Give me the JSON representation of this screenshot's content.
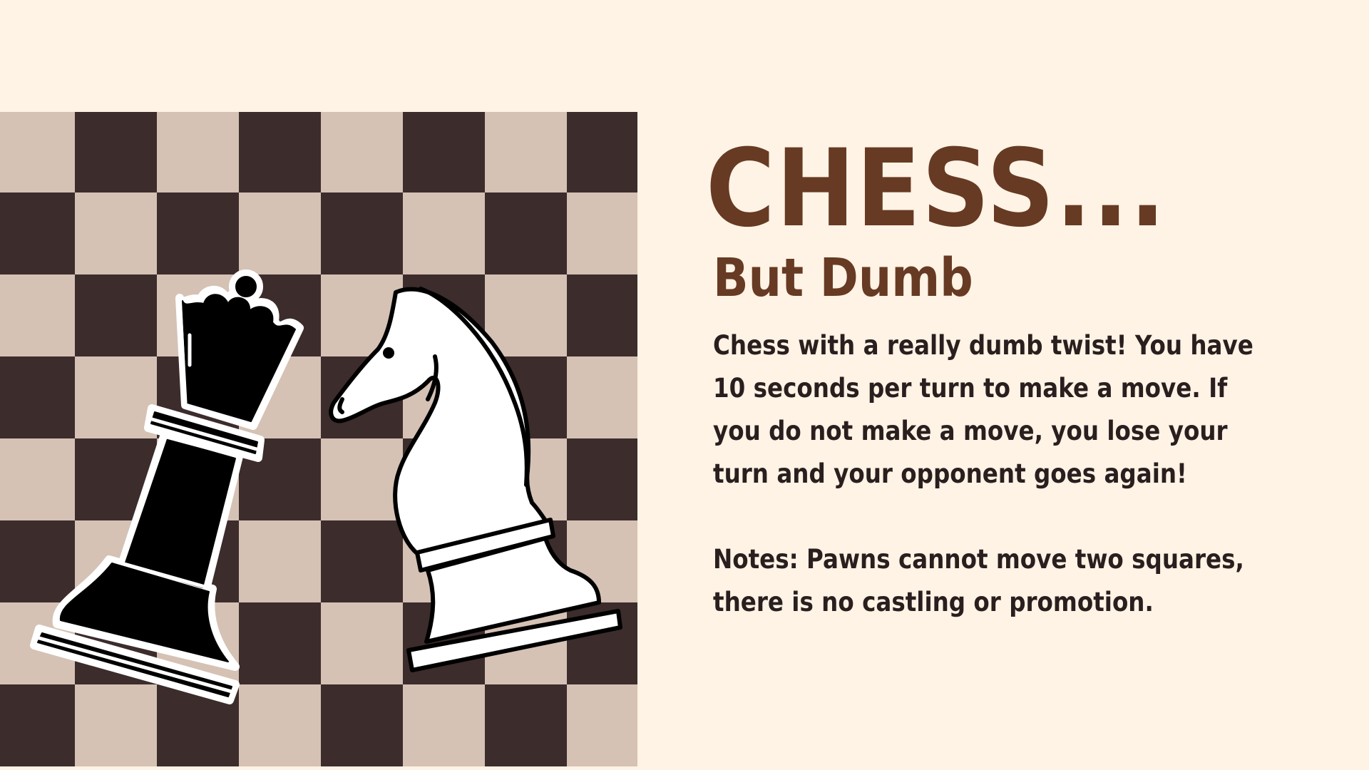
{
  "slide": {
    "title": "CHESS...",
    "subtitle": "But Dumb",
    "description": "Chess with a really dumb twist! You have 10 seconds per turn to make a move. If you do not make a move, you lose your turn and your opponent goes again!",
    "notes": "Notes: Pawns cannot move two squares, there is no castling or promotion."
  },
  "board": {
    "light_color": "#D5C2B5",
    "dark_color": "#3C2C2C",
    "ranks": 8,
    "files": 8
  },
  "pieces": [
    {
      "name": "black-queen",
      "color": "#000000"
    },
    {
      "name": "white-knight",
      "color": "#FFFFFF"
    }
  ],
  "colors": {
    "background": "#FEF3E5",
    "heading": "#673A23",
    "body_text": "#2A1F1E"
  }
}
